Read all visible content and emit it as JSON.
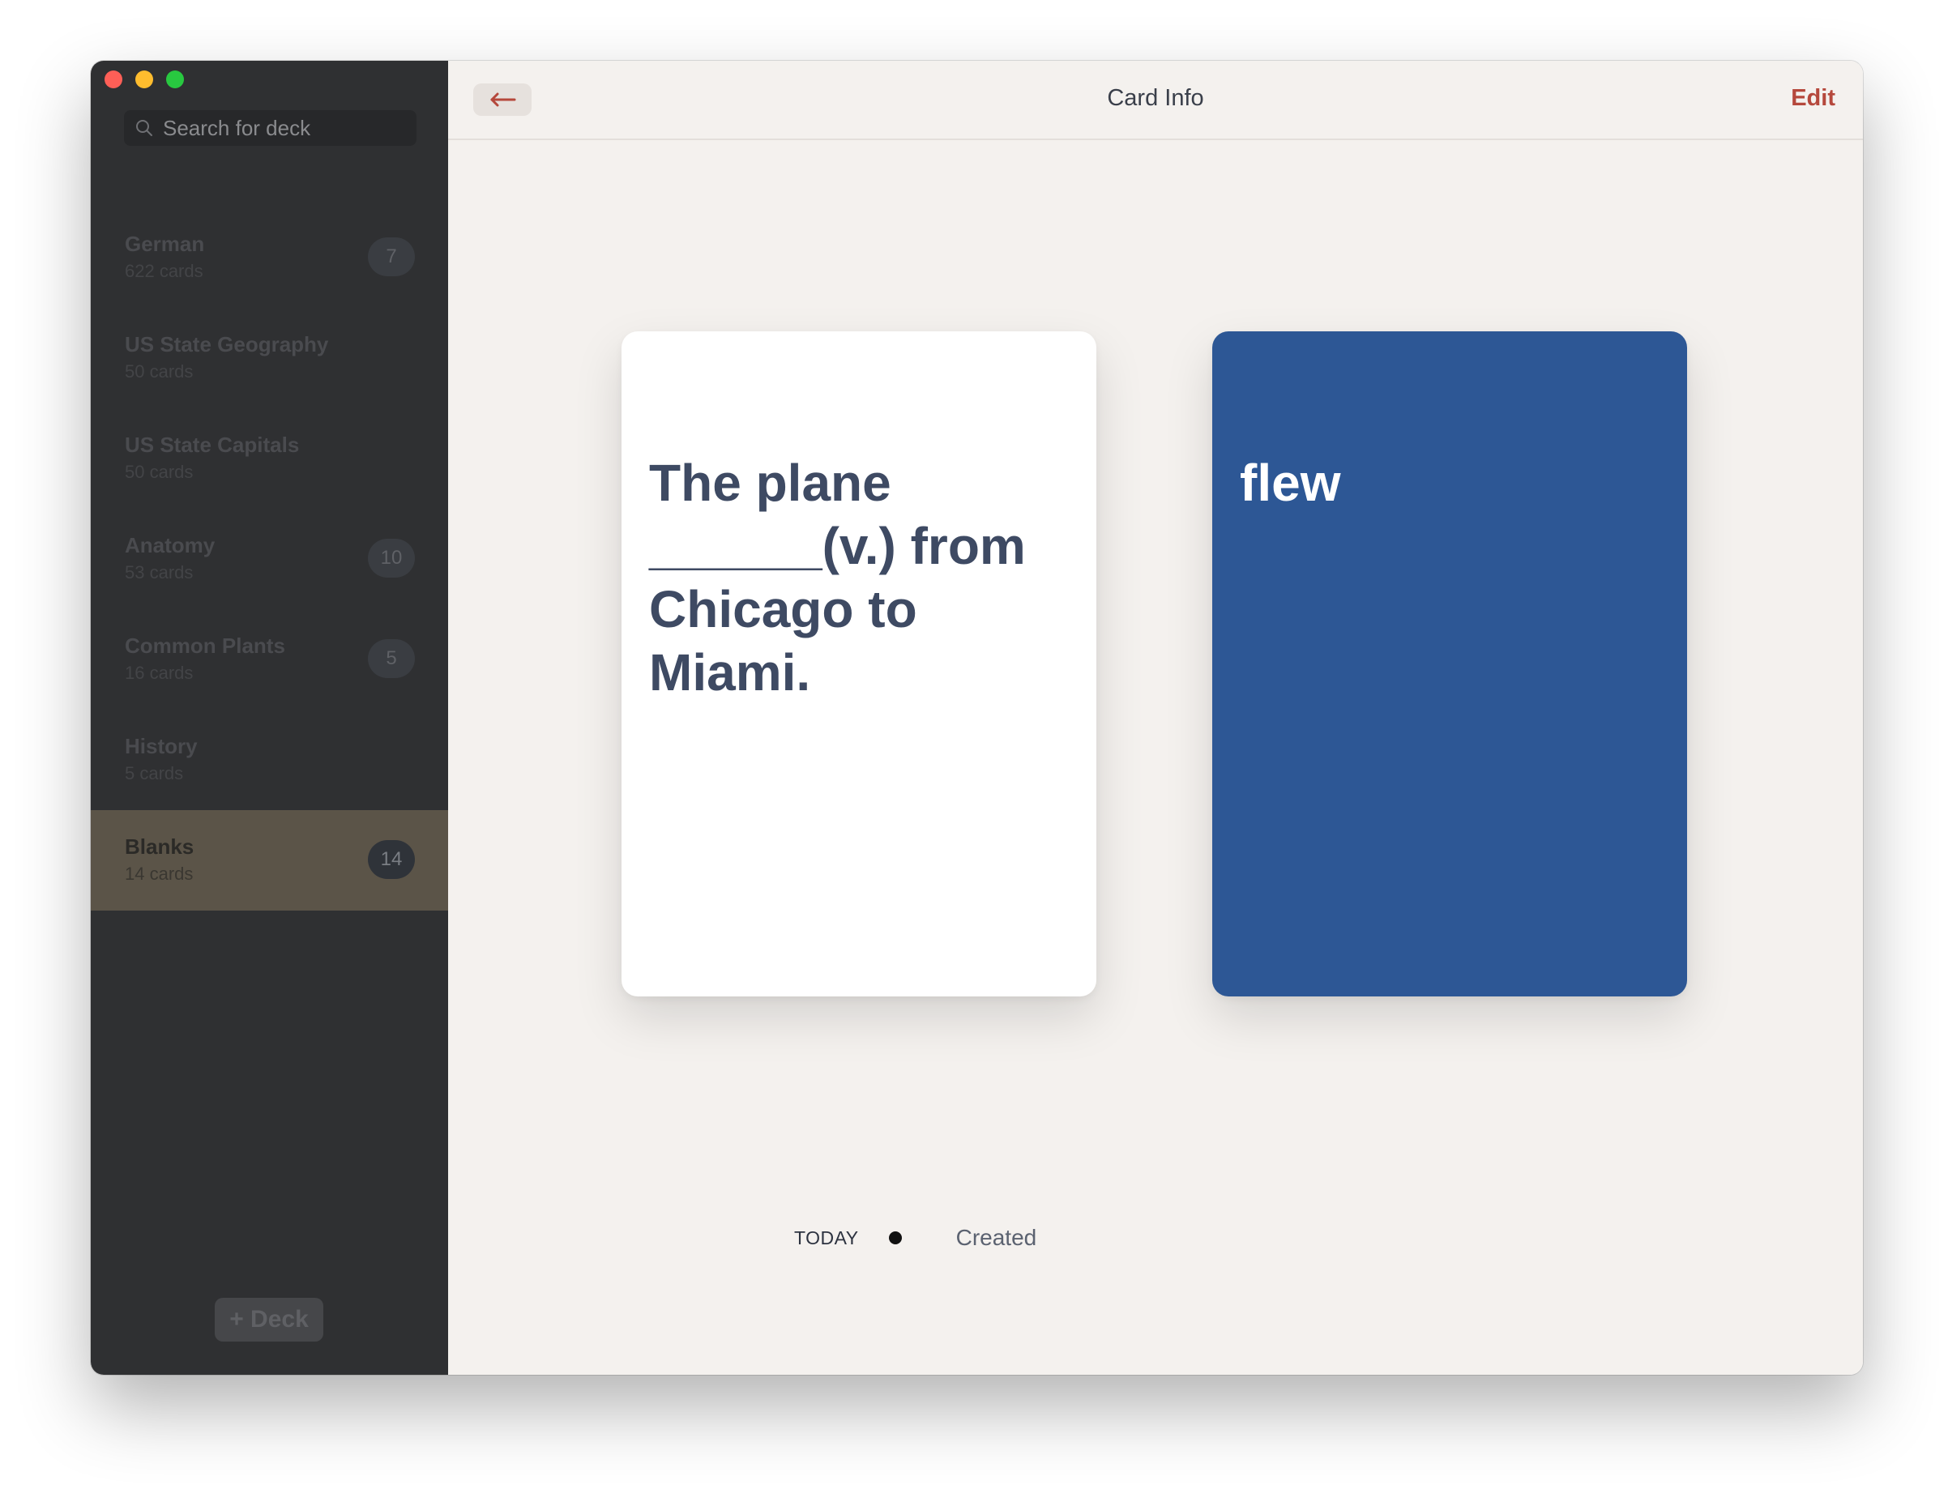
{
  "sidebar": {
    "search": {
      "placeholder": "Search for deck"
    },
    "decks": [
      {
        "name": "German",
        "count": "622 cards",
        "badge": "7"
      },
      {
        "name": "US State Geography",
        "count": "50 cards",
        "badge": ""
      },
      {
        "name": "US State Capitals",
        "count": "50 cards",
        "badge": ""
      },
      {
        "name": "Anatomy",
        "count": "53 cards",
        "badge": "10"
      },
      {
        "name": "Common Plants",
        "count": "16 cards",
        "badge": "5"
      },
      {
        "name": "History",
        "count": "5 cards",
        "badge": ""
      },
      {
        "name": "Blanks",
        "count": "14 cards",
        "badge": "14",
        "selected": true
      }
    ],
    "add_deck_label": "+ Deck"
  },
  "toolbar": {
    "title": "Card Info",
    "edit_label": "Edit"
  },
  "card": {
    "front_text": "The plane ______(v.) from Chicago to Miami.",
    "back_text": "flew",
    "back_color": "#2d5795"
  },
  "timeline": {
    "date": "TODAY",
    "event": "Created"
  },
  "colors": {
    "accent": "#b5483c",
    "sidebar_bg": "#2f3032",
    "selected_deck_bg": "#5b5448",
    "main_bg": "#f4f1ee"
  }
}
